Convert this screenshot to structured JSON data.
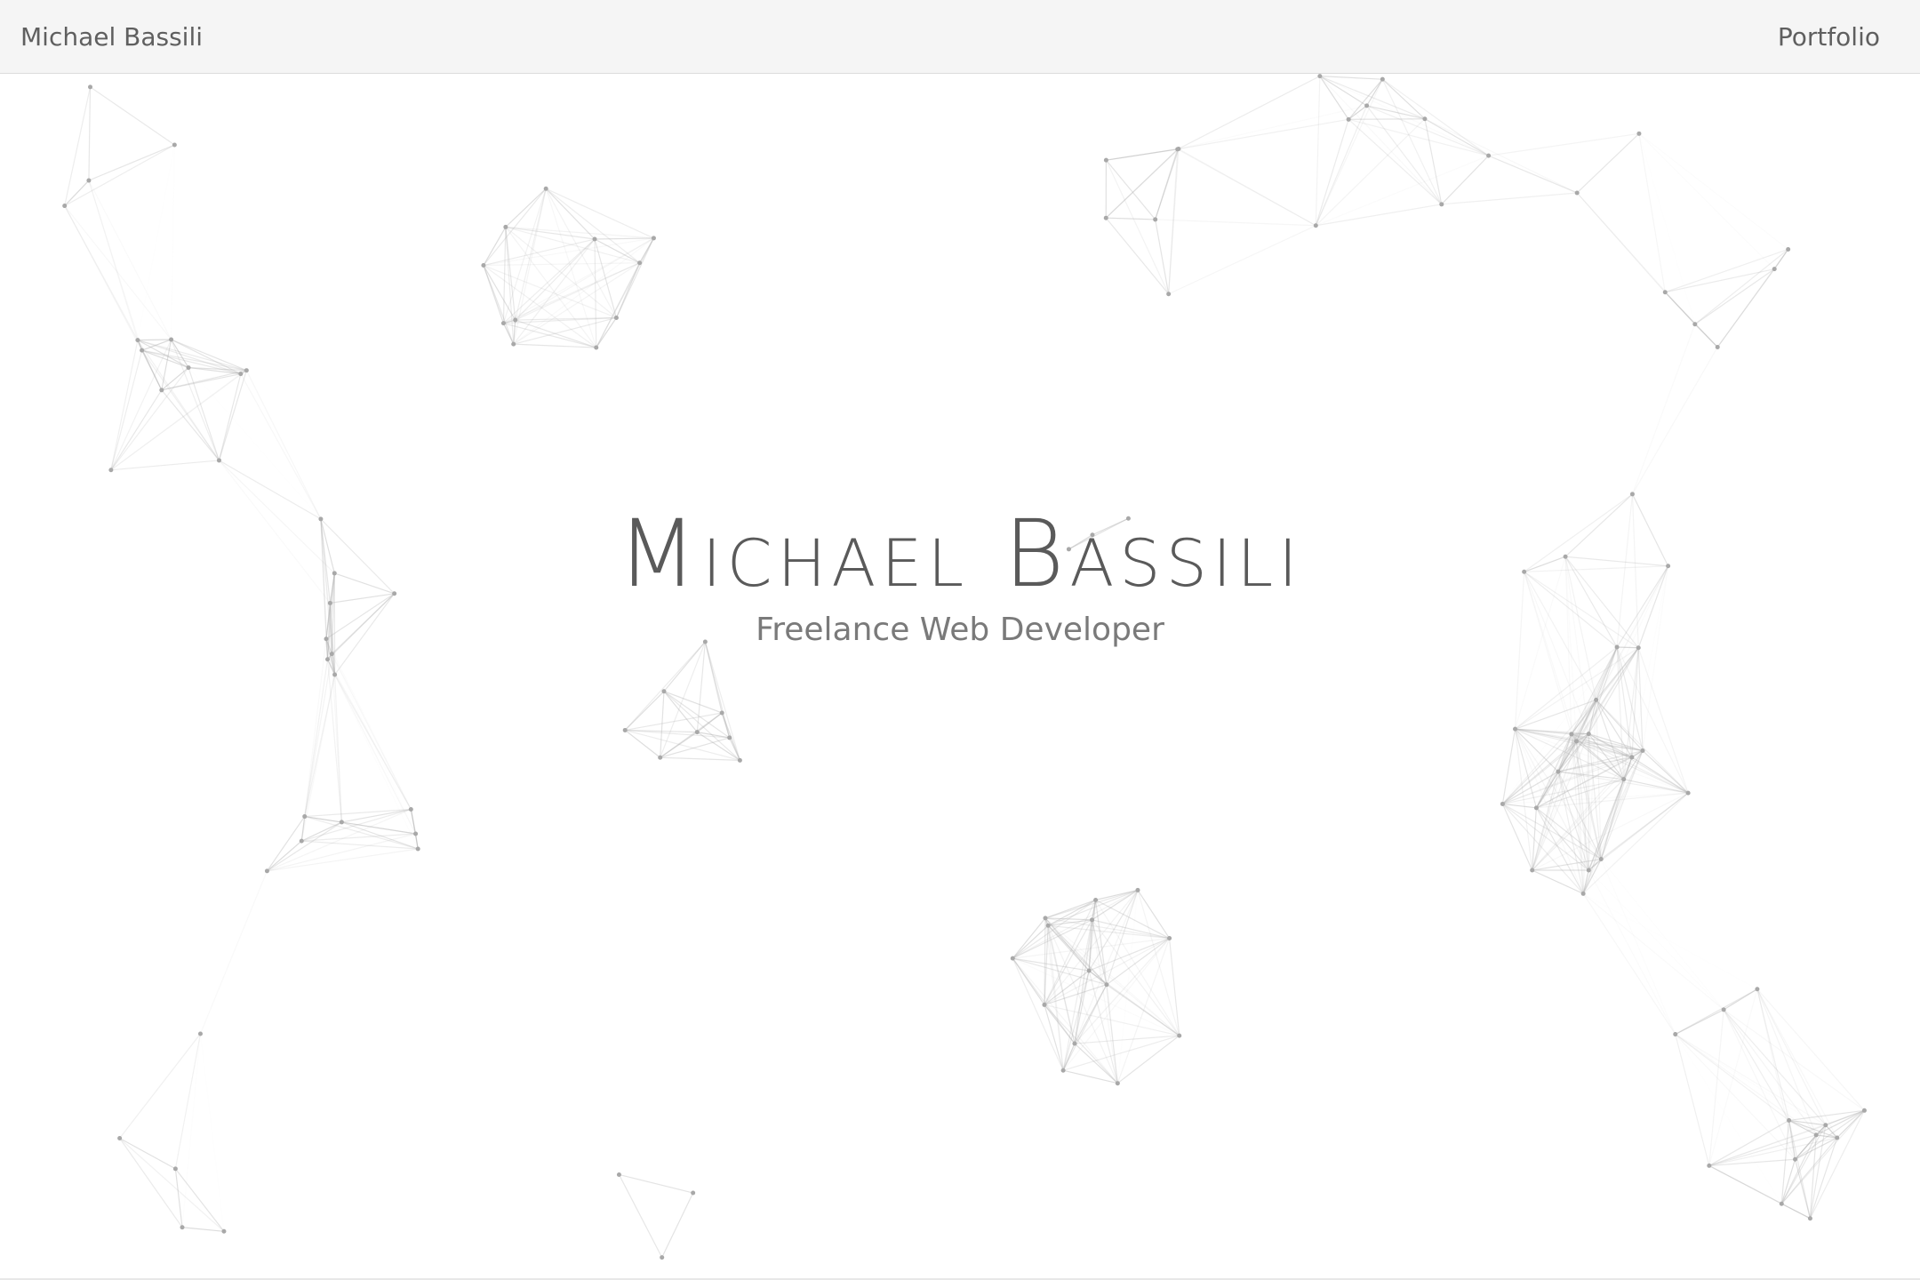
{
  "navbar": {
    "brand": "Michael Bassili",
    "links": [
      {
        "label": "Portfolio"
      }
    ]
  },
  "hero": {
    "title": "Michael Bassili",
    "subtitle": "Freelance Web Developer"
  },
  "colors": {
    "navbar_bg": "#f5f5f5",
    "text": "#5f5f5f",
    "network_lines": "#b0b0b0"
  }
}
